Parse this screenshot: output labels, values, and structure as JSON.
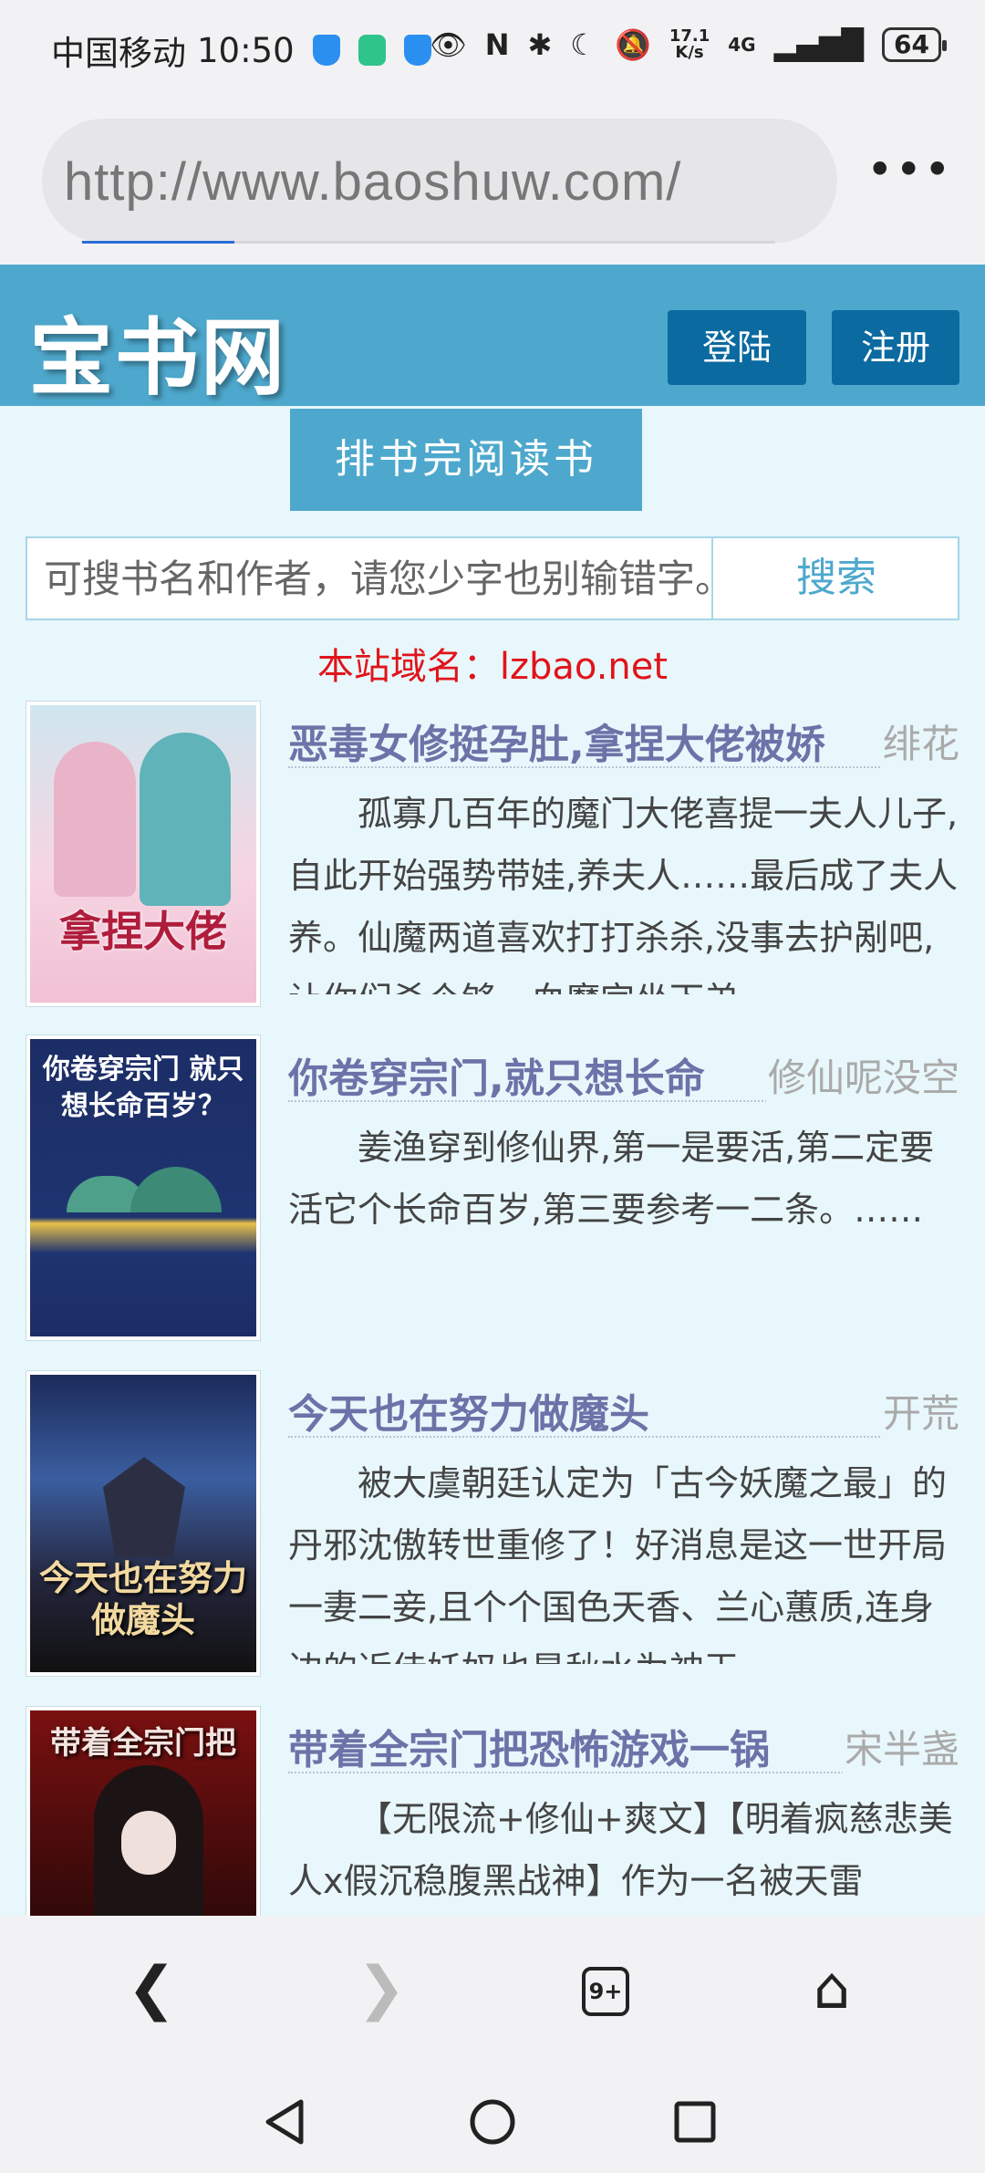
{
  "status": {
    "carrier": "中国移动",
    "time": "10:50",
    "net_speed_top": "17.1",
    "net_speed_bottom": "K/s",
    "network": "4G",
    "battery": "64"
  },
  "browser": {
    "url": "http://www.baoshuw.com/",
    "menu_icon": "more-dots-icon",
    "load_progress": 0.22
  },
  "site": {
    "logo": "宝书网",
    "login_label": "登陆",
    "register_label": "注册",
    "nav_tab": "排书完阅读书",
    "search_placeholder": "可搜书名和作者，请您少字也别输错字。",
    "search_button": "搜索",
    "domain_notice": "本站域名：lzbao.net"
  },
  "books": [
    {
      "title": "恶毒女修挺孕肚,拿捏大佬被娇",
      "author": "绯花",
      "description": "孤寡几百年的魔门大佬喜提一夫人儿子,自此开始强势带娃,养夫人……最后成了夫人养。仙魔两道喜欢打打杀杀,没事去护剐吧,让你们杀个够。血魔宫坐下弟",
      "cover_text": "拿捏大佬"
    },
    {
      "title": "你卷穿宗门,就只想长命",
      "author": "修仙呢没空",
      "description": "姜渔穿到修仙界,第一是要活,第二定要活它个长命百岁,第三要参考一二条。……",
      "cover_text": "你卷穿宗门 就只想长命百岁？"
    },
    {
      "title": "今天也在努力做魔头",
      "author": "开荒",
      "description": "被大虞朝廷认定为「古今妖魔之最」的丹邪沈傲转世重修了！好消息是这一世开局一妻二妾,且个个国色天香、兰心蕙质,连身边的近侍妖奴也是秋水为神玉",
      "cover_text": "今天也在努力做魔头"
    },
    {
      "title": "带着全宗门把恐怖游戏一锅",
      "author": "宋半盏",
      "description": "【无限流+修仙+爽文】【明着疯慈悲美人x假沉稳腹黑战神】作为一名被天雷",
      "cover_text": "带着全宗门把"
    }
  ],
  "bottom_nav": {
    "tab_count": "9+"
  }
}
